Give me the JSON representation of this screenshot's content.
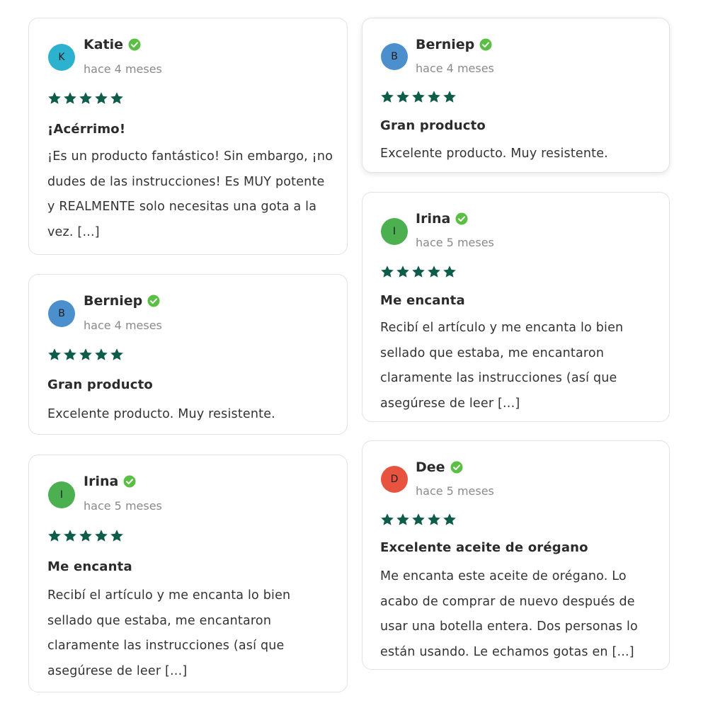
{
  "colors": {
    "star": "#0e5c4a",
    "verified": "#5cbf45",
    "avatar_katie": "#2cb2cf",
    "avatar_berniep": "#4b8fcc",
    "avatar_irina": "#4caf50",
    "avatar_dee": "#e8533f"
  },
  "reviews": [
    {
      "initial": "K",
      "name": "Katie",
      "time": "hace 4 meses",
      "rating": 5,
      "title": "¡Acérrimo!",
      "body": "¡Es un producto fantástico! Sin embargo, ¡no dudes de las instrucciones! Es MUY potente y REALMENTE solo necesitas una gota a la vez. [...]"
    },
    {
      "initial": "B",
      "name": "Berniep",
      "time": "hace 4 meses",
      "rating": 5,
      "title": "Gran producto",
      "body": "Excelente producto. Muy resistente."
    },
    {
      "initial": "I",
      "name": "Irina",
      "time": "hace 5 meses",
      "rating": 5,
      "title": "Me encanta",
      "body": "Recibí el artículo y me encanta lo bien sellado que estaba, me encantaron claramente las instrucciones (así que asegúrese de leer [...]"
    },
    {
      "initial": "B",
      "name": "Berniep",
      "time": "hace 4 meses",
      "rating": 5,
      "title": "Gran producto",
      "body": "Excelente producto. Muy resistente."
    },
    {
      "initial": "I",
      "name": "Irina",
      "time": "hace 5 meses",
      "rating": 5,
      "title": "Me encanta",
      "body": "Recibí el artículo y me encanta lo bien sellado que estaba, me encantaron claramente las instrucciones (así que asegúrese de leer [...]"
    },
    {
      "initial": "D",
      "name": "Dee",
      "time": "hace 5 meses",
      "rating": 5,
      "title": "Excelente aceite de orégano",
      "body": "Me encanta este aceite de orégano. Lo acabo de comprar de nuevo después de usar una botella entera. Dos personas lo están usando. Le echamos gotas en [...]"
    }
  ]
}
